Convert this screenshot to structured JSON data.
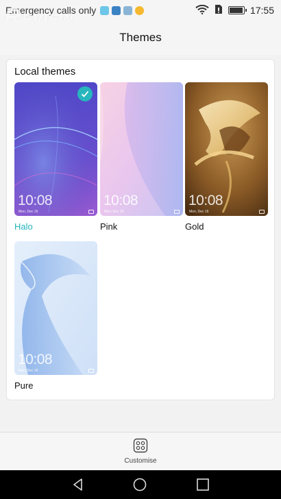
{
  "status_bar": {
    "carrier_text": "Emergency calls only",
    "time": "17:55",
    "battery_level": 0.85,
    "icons": [
      "wifi-icon",
      "sim-icon",
      "battery-icon"
    ],
    "notification_icon_colors": [
      "#6ec6e8",
      "#3b82c4",
      "#8ab4d6",
      "#f5b82e"
    ]
  },
  "watermark": {
    "text": "REVIEW"
  },
  "header": {
    "title": "Themes"
  },
  "local_themes": {
    "heading": "Local themes",
    "items": [
      {
        "label": "Halo",
        "selected": true,
        "clock": "10:08",
        "date": "Mon, Dec 16"
      },
      {
        "label": "Pink",
        "selected": false,
        "clock": "10:08",
        "date": "Mon, Dec 16"
      },
      {
        "label": "Gold",
        "selected": false,
        "clock": "10:08",
        "date": "Mon, Dec 16"
      },
      {
        "label": "Pure",
        "selected": false,
        "clock": "10:08",
        "date": "Mon, Dec 16"
      }
    ]
  },
  "bottom_bar": {
    "customise_label": "Customise",
    "icon": "customise-icon"
  },
  "nav_bar": {
    "icons": [
      "back-icon",
      "home-icon",
      "recents-icon"
    ]
  },
  "colors": {
    "accent": "#22b4bb",
    "nav_background": "#000000",
    "page_background": "#f2f2f2"
  }
}
